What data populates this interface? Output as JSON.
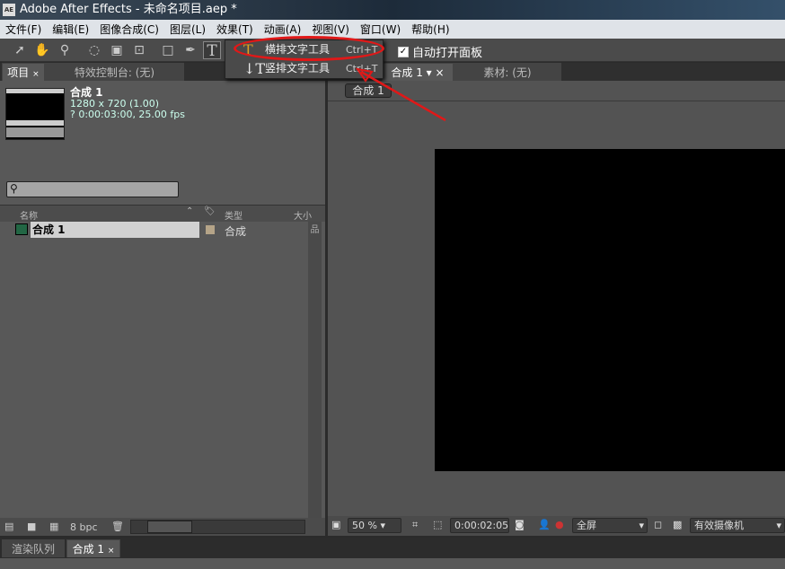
{
  "title": "Adobe After Effects - 未命名项目.aep *",
  "logo": "AE",
  "menu": [
    "文件(F)",
    "编辑(E)",
    "图像合成(C)",
    "图层(L)",
    "效果(T)",
    "动画(A)",
    "视图(V)",
    "窗口(W)",
    "帮助(H)"
  ],
  "toolbar": {
    "auto_open": "自动打开面板"
  },
  "dropdown": [
    {
      "label": "横排文字工具",
      "shortcut": "Ctrl+T"
    },
    {
      "label": "竖排文字工具",
      "shortcut": "Ctrl+T"
    }
  ],
  "tabs": {
    "project": "项目",
    "effects": "特效控制台: (无)",
    "comp": "合成 1",
    "footage": "素材: (无)"
  },
  "project": {
    "name": "合成 1",
    "dims": "1280 x 720 (1.00)",
    "duration": "? 0:00:03:00, 25.00 fps",
    "columns": [
      "名称",
      "类型",
      "大小"
    ],
    "items": [
      {
        "name": "合成 1",
        "type": "合成"
      }
    ],
    "bpc": "8 bpc"
  },
  "viewer": {
    "comp_label": "合成 1",
    "zoom": "50 %",
    "timecode": "0:00:02:05",
    "resolution": "全屏",
    "camera": "有效摄像机"
  },
  "bottom_tabs": [
    "渲染队列",
    "合成 1"
  ],
  "accent": "#e01818"
}
